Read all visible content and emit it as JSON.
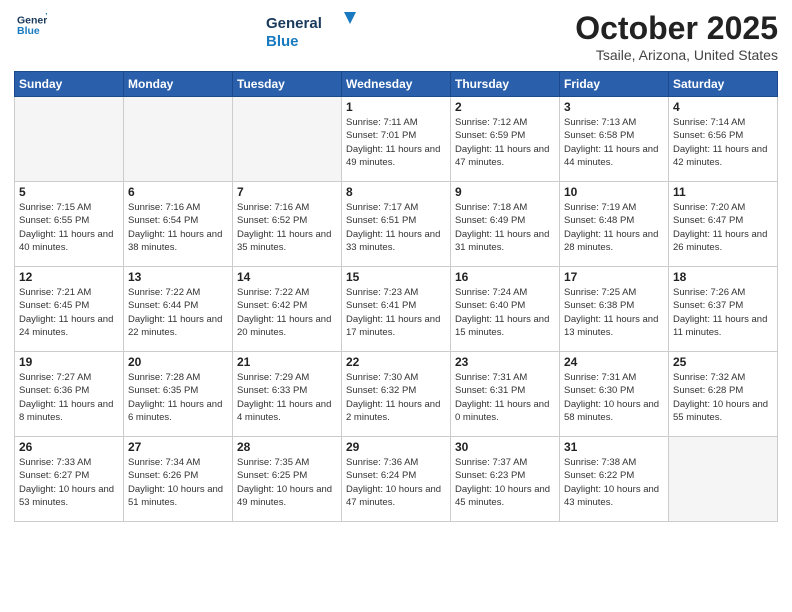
{
  "header": {
    "logo": {
      "general": "General",
      "blue": "Blue"
    },
    "title": "October 2025",
    "location": "Tsaile, Arizona, United States"
  },
  "days_of_week": [
    "Sunday",
    "Monday",
    "Tuesday",
    "Wednesday",
    "Thursday",
    "Friday",
    "Saturday"
  ],
  "weeks": [
    [
      {
        "day": "",
        "empty": true
      },
      {
        "day": "",
        "empty": true
      },
      {
        "day": "",
        "empty": true
      },
      {
        "day": "1",
        "sunrise": "7:11 AM",
        "sunset": "7:01 PM",
        "daylight": "11 hours and 49 minutes."
      },
      {
        "day": "2",
        "sunrise": "7:12 AM",
        "sunset": "6:59 PM",
        "daylight": "11 hours and 47 minutes."
      },
      {
        "day": "3",
        "sunrise": "7:13 AM",
        "sunset": "6:58 PM",
        "daylight": "11 hours and 44 minutes."
      },
      {
        "day": "4",
        "sunrise": "7:14 AM",
        "sunset": "6:56 PM",
        "daylight": "11 hours and 42 minutes."
      }
    ],
    [
      {
        "day": "5",
        "sunrise": "7:15 AM",
        "sunset": "6:55 PM",
        "daylight": "11 hours and 40 minutes."
      },
      {
        "day": "6",
        "sunrise": "7:16 AM",
        "sunset": "6:54 PM",
        "daylight": "11 hours and 38 minutes."
      },
      {
        "day": "7",
        "sunrise": "7:16 AM",
        "sunset": "6:52 PM",
        "daylight": "11 hours and 35 minutes."
      },
      {
        "day": "8",
        "sunrise": "7:17 AM",
        "sunset": "6:51 PM",
        "daylight": "11 hours and 33 minutes."
      },
      {
        "day": "9",
        "sunrise": "7:18 AM",
        "sunset": "6:49 PM",
        "daylight": "11 hours and 31 minutes."
      },
      {
        "day": "10",
        "sunrise": "7:19 AM",
        "sunset": "6:48 PM",
        "daylight": "11 hours and 28 minutes."
      },
      {
        "day": "11",
        "sunrise": "7:20 AM",
        "sunset": "6:47 PM",
        "daylight": "11 hours and 26 minutes."
      }
    ],
    [
      {
        "day": "12",
        "sunrise": "7:21 AM",
        "sunset": "6:45 PM",
        "daylight": "11 hours and 24 minutes."
      },
      {
        "day": "13",
        "sunrise": "7:22 AM",
        "sunset": "6:44 PM",
        "daylight": "11 hours and 22 minutes."
      },
      {
        "day": "14",
        "sunrise": "7:22 AM",
        "sunset": "6:42 PM",
        "daylight": "11 hours and 20 minutes."
      },
      {
        "day": "15",
        "sunrise": "7:23 AM",
        "sunset": "6:41 PM",
        "daylight": "11 hours and 17 minutes."
      },
      {
        "day": "16",
        "sunrise": "7:24 AM",
        "sunset": "6:40 PM",
        "daylight": "11 hours and 15 minutes."
      },
      {
        "day": "17",
        "sunrise": "7:25 AM",
        "sunset": "6:38 PM",
        "daylight": "11 hours and 13 minutes."
      },
      {
        "day": "18",
        "sunrise": "7:26 AM",
        "sunset": "6:37 PM",
        "daylight": "11 hours and 11 minutes."
      }
    ],
    [
      {
        "day": "19",
        "sunrise": "7:27 AM",
        "sunset": "6:36 PM",
        "daylight": "11 hours and 8 minutes."
      },
      {
        "day": "20",
        "sunrise": "7:28 AM",
        "sunset": "6:35 PM",
        "daylight": "11 hours and 6 minutes."
      },
      {
        "day": "21",
        "sunrise": "7:29 AM",
        "sunset": "6:33 PM",
        "daylight": "11 hours and 4 minutes."
      },
      {
        "day": "22",
        "sunrise": "7:30 AM",
        "sunset": "6:32 PM",
        "daylight": "11 hours and 2 minutes."
      },
      {
        "day": "23",
        "sunrise": "7:31 AM",
        "sunset": "6:31 PM",
        "daylight": "11 hours and 0 minutes."
      },
      {
        "day": "24",
        "sunrise": "7:31 AM",
        "sunset": "6:30 PM",
        "daylight": "10 hours and 58 minutes."
      },
      {
        "day": "25",
        "sunrise": "7:32 AM",
        "sunset": "6:28 PM",
        "daylight": "10 hours and 55 minutes."
      }
    ],
    [
      {
        "day": "26",
        "sunrise": "7:33 AM",
        "sunset": "6:27 PM",
        "daylight": "10 hours and 53 minutes."
      },
      {
        "day": "27",
        "sunrise": "7:34 AM",
        "sunset": "6:26 PM",
        "daylight": "10 hours and 51 minutes."
      },
      {
        "day": "28",
        "sunrise": "7:35 AM",
        "sunset": "6:25 PM",
        "daylight": "10 hours and 49 minutes."
      },
      {
        "day": "29",
        "sunrise": "7:36 AM",
        "sunset": "6:24 PM",
        "daylight": "10 hours and 47 minutes."
      },
      {
        "day": "30",
        "sunrise": "7:37 AM",
        "sunset": "6:23 PM",
        "daylight": "10 hours and 45 minutes."
      },
      {
        "day": "31",
        "sunrise": "7:38 AM",
        "sunset": "6:22 PM",
        "daylight": "10 hours and 43 minutes."
      },
      {
        "day": "",
        "empty": true
      }
    ]
  ]
}
